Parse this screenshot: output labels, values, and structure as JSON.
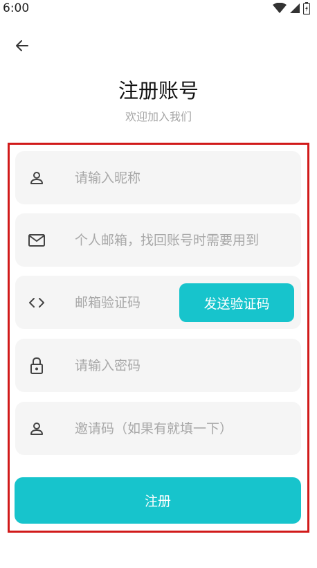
{
  "status_bar": {
    "time": "6:00",
    "icons": [
      "wifi-icon",
      "cellular-signal-icon",
      "battery-icon"
    ]
  },
  "header": {
    "back_icon": "arrow-left-icon",
    "title": "注册账号",
    "subtitle": "欢迎加入我们"
  },
  "form": {
    "nickname": {
      "icon": "user-icon",
      "value": "",
      "placeholder": "请输入昵称"
    },
    "email": {
      "icon": "mail-icon",
      "value": "",
      "placeholder": "个人邮箱，找回账号时需要用到"
    },
    "email_code": {
      "icon": "code-icon",
      "value": "",
      "placeholder": "邮箱验证码",
      "send_button_label": "发送验证码"
    },
    "password": {
      "icon": "lock-icon",
      "value": "",
      "placeholder": "请输入密码"
    },
    "invite_code": {
      "icon": "user-icon",
      "value": "",
      "placeholder": "邀请码（如果有就填一下）"
    },
    "submit_label": "注册"
  },
  "colors": {
    "accent": "#17c4cc",
    "field_background": "#f5f5f5",
    "highlight_border": "#d11a1a",
    "placeholder": "#a8a8a8"
  }
}
